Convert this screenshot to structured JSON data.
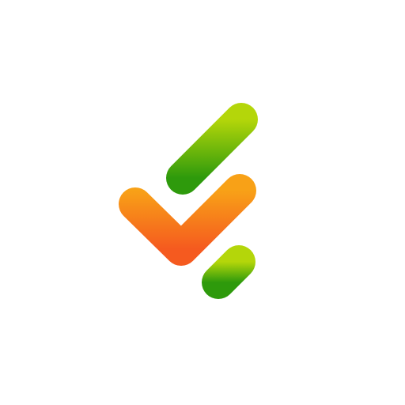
{
  "colors": {
    "background": "#ffffff",
    "green_light": "#b4d60a",
    "green_dark": "#2e9a0c",
    "orange_light": "#f8a117",
    "orange_dark": "#f55a1f"
  },
  "icon": {
    "name": "checkmark-logo-icon"
  }
}
